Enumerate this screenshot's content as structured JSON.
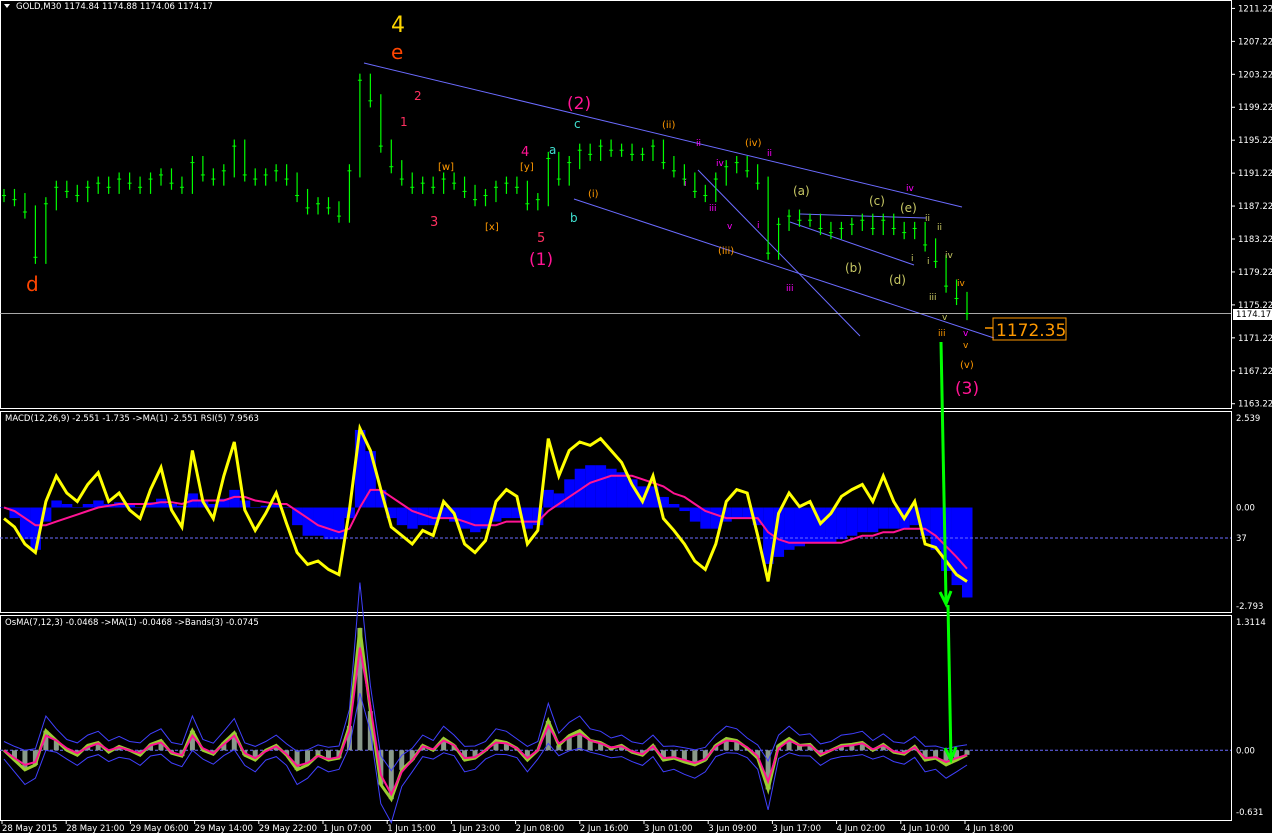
{
  "colors": {
    "background": "#000000",
    "candles": "#00ff00",
    "channel": "#6b6bff",
    "grid": "#ffffff",
    "macd_hist": "#0000ff",
    "macd_signal": "#ff1493",
    "rsi": "#ffff00",
    "osma_fast": "#9acd32",
    "osma_signal": "#ff1493",
    "bands": "#4040ff",
    "arrow": "#00ff00",
    "price_box": "#ff9900"
  },
  "header": {
    "symbol": "GOLD,M30  1174.84 1174.88 1174.06 1174.17",
    "macd": "MACD(12,26,9) -2.551 -1.735  ->MA(1) -2.551  RSI(5) 7.9563",
    "osma": "OsMA(7,12,3) -0.0468  ->MA(1) -0.0468  ->Bands(3) -0.0745"
  },
  "price_label": "1172.35",
  "current_price": "1174.17",
  "wave_labels": {
    "big4": "4",
    "e": "e",
    "d": "d",
    "two_paren": "(2)",
    "one_paren": "(1)",
    "three_paren": "(3)",
    "a": "a",
    "b": "b",
    "c": "c",
    "n1": "1",
    "n2": "2",
    "n3": "3",
    "n4": "4",
    "n5": "5",
    "w": "[w]",
    "x": "[x]",
    "y": "[y]",
    "i_p": "(i)",
    "ii_p": "(ii)",
    "iii_p": "(iii)",
    "iv_p": "(iv)",
    "v_p": "(v)",
    "a_p": "(a)",
    "b_p": "(b)",
    "c_p": "(c)",
    "d_p": "(d)",
    "e_p": "(e)",
    "r_i": "i",
    "r_ii": "ii",
    "r_iii": "iii",
    "r_iv": "iv",
    "r_v": "v"
  },
  "chart_data": [
    {
      "type": "line",
      "title": "GOLD,M30",
      "x": [
        "28 May 2015",
        "28 May 21:00",
        "29 May 06:00",
        "29 May 14:00",
        "29 May 22:00",
        "1 Jun 07:00",
        "1 Jun 15:00",
        "1 Jun 23:00",
        "2 Jun 08:00",
        "2 Jun 16:00",
        "3 Jun 01:00",
        "3 Jun 09:00",
        "3 Jun 17:00",
        "4 Jun 02:00",
        "4 Jun 10:00",
        "4 Jun 18:00"
      ],
      "y_ticks": [
        1211.22,
        1207.22,
        1203.22,
        1199.22,
        1195.22,
        1191.22,
        1187.22,
        1183.22,
        1179.22,
        1175.22,
        1171.22,
        1167.22,
        1163.22
      ],
      "ylim": [
        1162.7,
        1212.0
      ],
      "series": [
        {
          "values": [
            1188.5,
            1188.0,
            1186.5,
            1181.0,
            1187.5,
            1189.5,
            1189.0,
            1188.5,
            1189.5,
            1190.0,
            1189.5,
            1190.5,
            1190.0,
            1189.5,
            1190.5,
            1191.0,
            1190.0,
            1189.5,
            1192.5,
            1191.0,
            1190.5,
            1191.5,
            1194.5,
            1191.0,
            1190.5,
            1191.0,
            1191.5,
            1190.5,
            1188.5,
            1187.0,
            1187.5,
            1187.0,
            1186.0,
            1191.5,
            1202.5,
            1200.0,
            1194.5,
            1192.0,
            1190.5,
            1189.5,
            1190.0,
            1189.5,
            1190.5,
            1190.0,
            1189.0,
            1188.0,
            1188.5,
            1189.5,
            1190.0,
            1189.5,
            1187.5,
            1188.0,
            1193.0,
            1190.5,
            1192.5,
            1194.0,
            1193.5,
            1194.5,
            1194.0,
            1194.0,
            1193.5,
            1193.5,
            1194.5,
            1192.5,
            1191.5,
            1190.5,
            1189.0,
            1188.5,
            1190.5,
            1192.0,
            1192.5,
            1191.5,
            1190.0,
            1181.5,
            1185.0,
            1186.0,
            1185.5,
            1185.5,
            1184.5,
            1184.0,
            1184.5,
            1185.0,
            1185.5,
            1184.5,
            1185.5,
            1184.5,
            1184.0,
            1184.5,
            1182.5,
            1180.5,
            1177.5,
            1176.0,
            1174.17
          ]
        }
      ]
    },
    {
      "type": "line",
      "title": "MACD(12,26,9) -2.551 -1.735  ->MA(1) -2.551  RSI(5) 7.9563",
      "y_ticks": [
        2.539,
        0.0,
        -2.793
      ],
      "hline": "37",
      "ylim": [
        -2.793,
        2.539
      ],
      "series": [
        {
          "name": "MACD",
          "values": [
            0.0,
            -0.3,
            -0.9,
            -1.2,
            -0.4,
            0.2,
            0.1,
            0.0,
            0.1,
            0.2,
            0.1,
            0.15,
            0.1,
            0.0,
            0.15,
            0.25,
            0.1,
            0.05,
            0.4,
            0.2,
            0.1,
            0.25,
            0.5,
            0.2,
            0.0,
            0.05,
            0.1,
            0.0,
            -0.5,
            -0.8,
            -0.8,
            -0.9,
            -0.9,
            -0.3,
            2.2,
            1.6,
            0.5,
            -0.3,
            -0.5,
            -0.6,
            -0.5,
            -0.5,
            -0.3,
            -0.4,
            -0.6,
            -0.7,
            -0.6,
            -0.4,
            -0.3,
            -0.3,
            -0.6,
            -0.5,
            0.5,
            0.4,
            0.8,
            1.1,
            1.2,
            1.2,
            1.1,
            1.0,
            0.8,
            0.6,
            0.6,
            0.3,
            0.1,
            -0.1,
            -0.4,
            -0.6,
            -0.6,
            -0.4,
            -0.3,
            -0.3,
            -0.5,
            -1.6,
            -1.4,
            -1.2,
            -1.1,
            -1.0,
            -1.0,
            -1.0,
            -0.9,
            -0.8,
            -0.7,
            -0.7,
            -0.6,
            -0.6,
            -0.6,
            -0.5,
            -0.8,
            -1.2,
            -1.8,
            -2.2,
            -2.551
          ]
        },
        {
          "name": "Signal",
          "values": [
            0.0,
            -0.1,
            -0.3,
            -0.5,
            -0.5,
            -0.4,
            -0.3,
            -0.2,
            -0.1,
            0.0,
            0.05,
            0.1,
            0.1,
            0.1,
            0.1,
            0.15,
            0.15,
            0.1,
            0.2,
            0.2,
            0.2,
            0.2,
            0.3,
            0.3,
            0.2,
            0.15,
            0.1,
            0.1,
            -0.1,
            -0.3,
            -0.5,
            -0.6,
            -0.7,
            -0.6,
            0.0,
            0.5,
            0.5,
            0.3,
            0.1,
            -0.1,
            -0.2,
            -0.3,
            -0.3,
            -0.3,
            -0.4,
            -0.5,
            -0.5,
            -0.5,
            -0.4,
            -0.4,
            -0.4,
            -0.4,
            -0.1,
            0.1,
            0.3,
            0.5,
            0.7,
            0.8,
            0.9,
            0.9,
            0.9,
            0.8,
            0.7,
            0.6,
            0.4,
            0.3,
            0.1,
            -0.1,
            -0.2,
            -0.3,
            -0.3,
            -0.3,
            -0.3,
            -0.7,
            -0.9,
            -1.0,
            -1.0,
            -1.0,
            -1.0,
            -1.0,
            -1.0,
            -0.9,
            -0.8,
            -0.8,
            -0.7,
            -0.7,
            -0.6,
            -0.6,
            -0.6,
            -0.8,
            -1.1,
            -1.4,
            -1.735
          ]
        },
        {
          "name": "RSI(5)",
          "values": [
            45,
            40,
            30,
            25,
            55,
            70,
            60,
            55,
            65,
            72,
            55,
            60,
            50,
            45,
            62,
            75,
            50,
            40,
            85,
            55,
            45,
            70,
            90,
            50,
            38,
            48,
            60,
            42,
            25,
            18,
            20,
            15,
            12,
            50,
            98,
            85,
            62,
            40,
            35,
            30,
            38,
            35,
            55,
            48,
            30,
            25,
            32,
            55,
            62,
            58,
            30,
            38,
            92,
            70,
            85,
            90,
            88,
            92,
            85,
            78,
            65,
            55,
            70,
            45,
            38,
            30,
            20,
            15,
            30,
            55,
            62,
            60,
            35,
            8,
            48,
            60,
            52,
            55,
            42,
            48,
            58,
            62,
            65,
            55,
            70,
            55,
            45,
            55,
            30,
            28,
            20,
            12,
            7.9563
          ]
        }
      ]
    },
    {
      "type": "line",
      "title": "OsMA(7,12,3) -0.0468  ->MA(1) -0.0468  ->Bands(3) -0.0745",
      "y_ticks": [
        1.3114,
        0.0,
        -0.631
      ],
      "ylim": [
        -0.631,
        1.3114
      ],
      "series": [
        {
          "name": "OsMA",
          "values": [
            0.0,
            -0.1,
            -0.2,
            -0.15,
            0.2,
            0.1,
            0.0,
            -0.05,
            0.05,
            0.08,
            -0.02,
            0.04,
            0.0,
            -0.05,
            0.06,
            0.1,
            -0.03,
            -0.06,
            0.2,
            0.0,
            -0.04,
            0.08,
            0.18,
            -0.05,
            -0.1,
            0.0,
            0.05,
            -0.05,
            -0.2,
            -0.15,
            -0.05,
            -0.1,
            -0.08,
            0.25,
            1.25,
            0.4,
            -0.35,
            -0.5,
            -0.2,
            -0.1,
            0.05,
            0.0,
            0.12,
            0.05,
            -0.1,
            -0.08,
            0.0,
            0.1,
            0.08,
            0.02,
            -0.1,
            0.0,
            0.3,
            0.05,
            0.15,
            0.2,
            0.1,
            0.08,
            0.02,
            0.05,
            -0.02,
            -0.05,
            0.05,
            -0.1,
            -0.08,
            -0.12,
            -0.15,
            -0.1,
            0.05,
            0.12,
            0.1,
            0.02,
            -0.08,
            -0.4,
            0.05,
            0.12,
            0.05,
            0.06,
            -0.05,
            0.0,
            0.05,
            0.06,
            0.08,
            0.0,
            0.06,
            -0.02,
            -0.04,
            0.04,
            -0.1,
            -0.08,
            -0.15,
            -0.1,
            -0.0468
          ]
        },
        {
          "name": "MA(1)",
          "values": [
            0.0,
            -0.08,
            -0.15,
            -0.12,
            0.15,
            0.1,
            0.02,
            -0.03,
            0.03,
            0.07,
            0.0,
            0.03,
            0.0,
            -0.03,
            0.05,
            0.08,
            -0.02,
            -0.05,
            0.15,
            0.02,
            -0.03,
            0.06,
            0.15,
            -0.03,
            -0.08,
            -0.01,
            0.04,
            -0.04,
            -0.16,
            -0.13,
            -0.06,
            -0.09,
            -0.07,
            0.2,
            1.05,
            0.45,
            -0.25,
            -0.45,
            -0.22,
            -0.1,
            0.04,
            0.01,
            0.1,
            0.05,
            -0.08,
            -0.07,
            0.0,
            0.08,
            0.07,
            0.02,
            -0.08,
            0.0,
            0.25,
            0.07,
            0.13,
            0.17,
            0.1,
            0.07,
            0.03,
            0.04,
            -0.01,
            -0.04,
            0.04,
            -0.08,
            -0.07,
            -0.1,
            -0.13,
            -0.09,
            0.04,
            0.1,
            0.09,
            0.03,
            -0.06,
            -0.32,
            0.02,
            0.1,
            0.05,
            0.05,
            -0.04,
            0.0,
            0.04,
            0.05,
            0.07,
            0.01,
            0.05,
            -0.01,
            -0.03,
            0.03,
            -0.08,
            -0.07,
            -0.12,
            -0.08,
            -0.0468
          ]
        }
      ]
    }
  ]
}
